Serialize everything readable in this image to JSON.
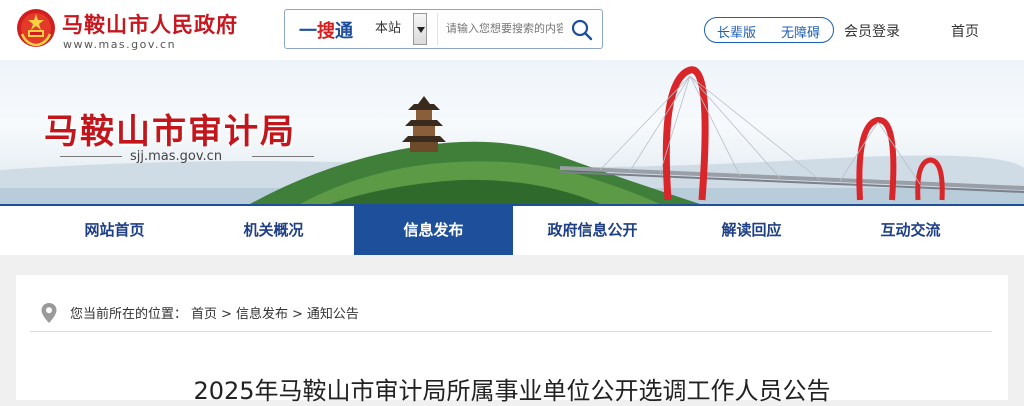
{
  "header": {
    "gov_name": "马鞍山市人民政府",
    "gov_url": "www.mas.gov.cn",
    "search": {
      "logo_prefix": "一",
      "logo_main": "搜",
      "logo_suffix": "通",
      "scope": "本站",
      "placeholder": "请输入您想要搜索的内容",
      "icon": "search-icon"
    },
    "elder_mode": "长辈版",
    "accessibility": "无障碍",
    "login": "会员登录",
    "home": "首页"
  },
  "banner": {
    "site_title": "马鞍山市审计局",
    "site_url": "sjj.mas.gov.cn"
  },
  "nav": {
    "items": [
      {
        "label": "网站首页",
        "active": false
      },
      {
        "label": "机关概况",
        "active": false
      },
      {
        "label": "信息发布",
        "active": true
      },
      {
        "label": "政府信息公开",
        "active": false
      },
      {
        "label": "解读回应",
        "active": false
      },
      {
        "label": "互动交流",
        "active": false
      }
    ]
  },
  "breadcrumb": {
    "prefix": "您当前所在的位置：",
    "items": [
      "首页",
      "信息发布",
      "通知公告"
    ],
    "separator": ">",
    "icon": "location-pin-icon"
  },
  "article": {
    "title": "2025年马鞍山市审计局所属事业单位公开选调工作人员公告"
  },
  "colors": {
    "brand_red": "#c7161e",
    "nav_blue": "#1e4f9a",
    "link_blue": "#1d5fb4"
  }
}
